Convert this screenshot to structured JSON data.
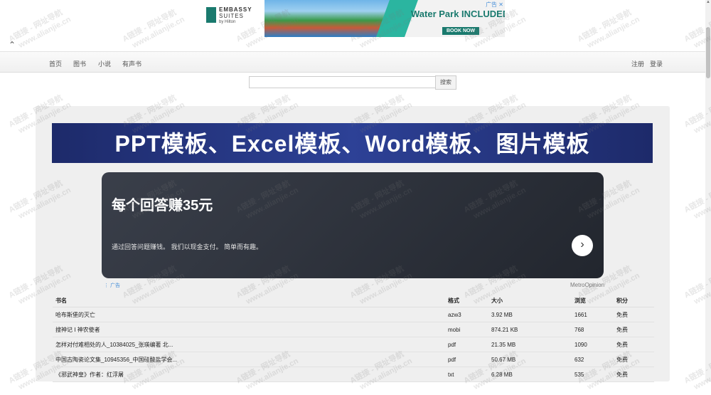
{
  "top_ad": {
    "logo_line1": "EMBASSY",
    "logo_line2": "SUITES",
    "logo_line3": "by Hilton",
    "headline": "Water Park INCLUDED!",
    "cta": "BOOK NOW",
    "ad_mark": "广告",
    "close": "✕"
  },
  "collapse_icon": "⌃",
  "nav": {
    "items": [
      "首页",
      "图书",
      "小说",
      "有声书"
    ],
    "register": "注册",
    "login": "登录"
  },
  "search": {
    "value": "",
    "placeholder": "",
    "button": "搜索"
  },
  "banner": {
    "text": "PPT模板、Excel模板、Word模板、图片模板"
  },
  "ad_card": {
    "headline": "每个回答赚35元",
    "body": "通过回答问题赚钱。 我们以现金支付。 简单而有趣。",
    "arrow": "›",
    "ad_label": "广告",
    "source": "MetroOpinion"
  },
  "table": {
    "headers": [
      "书名",
      "格式",
      "大小",
      "浏览",
      "积分"
    ],
    "rows": [
      [
        "哈布斯堡的灭亡",
        "azw3",
        "3.92 MB",
        "1661",
        "免费"
      ],
      [
        "搜神记 I 神农使者",
        "mobi",
        "874.21 KB",
        "768",
        "免费"
      ],
      [
        "怎样对付难相处的人_10384025_张瑛编著 北...",
        "pdf",
        "21.35 MB",
        "1090",
        "免费"
      ],
      [
        "中国古陶瓷论文集_10945356_中国硅酸盐学会...",
        "pdf",
        "50.67 MB",
        "632",
        "免费"
      ],
      [
        "《邪武神皇》作者：红浮屠",
        "txt",
        "6.28 MB",
        "535",
        "免费"
      ]
    ]
  },
  "watermark": {
    "line1": "A链接 - 网址导航",
    "line2": "www.alianjie.cn"
  },
  "colors": {
    "banner_bg": "#2d4196",
    "ad_card_bg": "#2a2e36",
    "brand_teal": "#1a7a6e"
  }
}
